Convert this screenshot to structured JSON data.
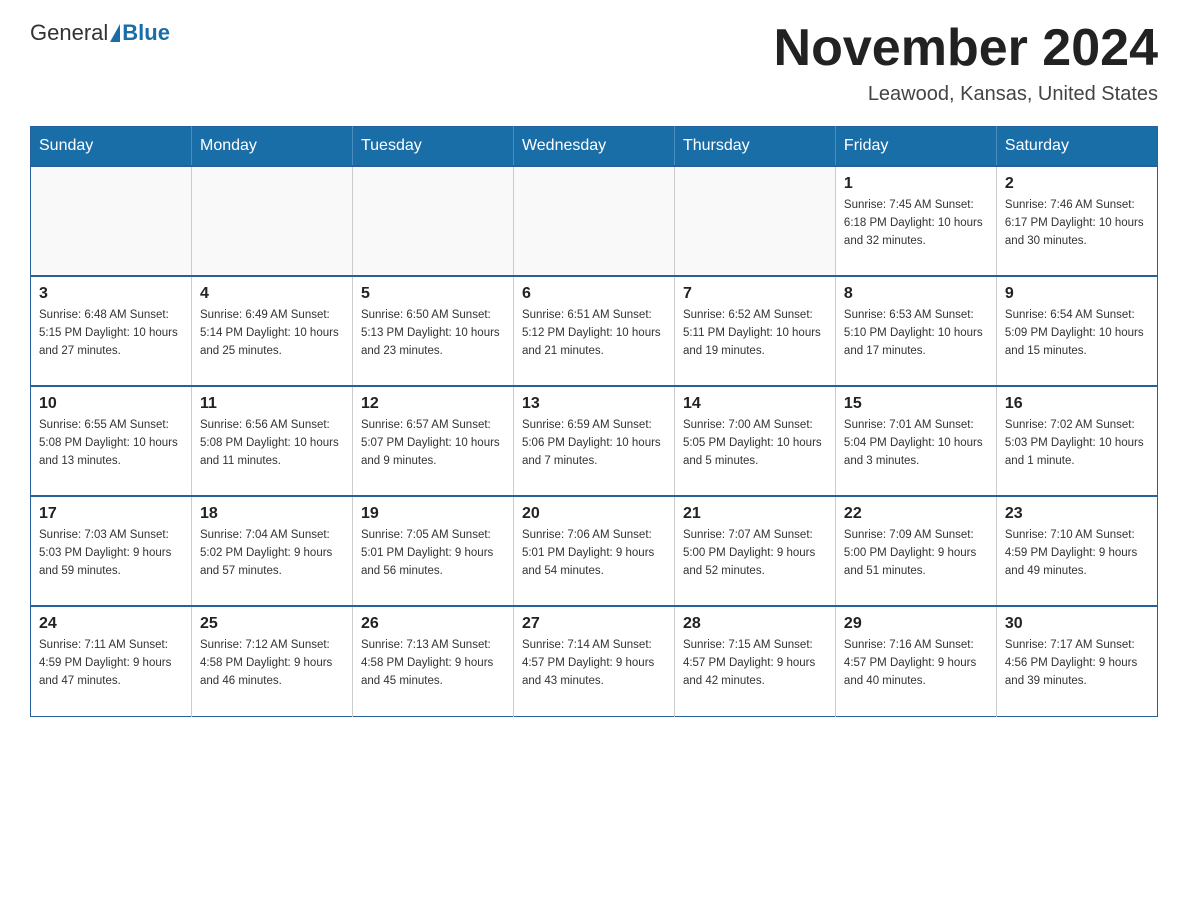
{
  "header": {
    "logo": {
      "general": "General",
      "blue": "Blue"
    },
    "title": "November 2024",
    "location": "Leawood, Kansas, United States"
  },
  "weekdays": [
    "Sunday",
    "Monday",
    "Tuesday",
    "Wednesday",
    "Thursday",
    "Friday",
    "Saturday"
  ],
  "weeks": [
    [
      {
        "day": "",
        "info": ""
      },
      {
        "day": "",
        "info": ""
      },
      {
        "day": "",
        "info": ""
      },
      {
        "day": "",
        "info": ""
      },
      {
        "day": "",
        "info": ""
      },
      {
        "day": "1",
        "info": "Sunrise: 7:45 AM\nSunset: 6:18 PM\nDaylight: 10 hours\nand 32 minutes."
      },
      {
        "day": "2",
        "info": "Sunrise: 7:46 AM\nSunset: 6:17 PM\nDaylight: 10 hours\nand 30 minutes."
      }
    ],
    [
      {
        "day": "3",
        "info": "Sunrise: 6:48 AM\nSunset: 5:15 PM\nDaylight: 10 hours\nand 27 minutes."
      },
      {
        "day": "4",
        "info": "Sunrise: 6:49 AM\nSunset: 5:14 PM\nDaylight: 10 hours\nand 25 minutes."
      },
      {
        "day": "5",
        "info": "Sunrise: 6:50 AM\nSunset: 5:13 PM\nDaylight: 10 hours\nand 23 minutes."
      },
      {
        "day": "6",
        "info": "Sunrise: 6:51 AM\nSunset: 5:12 PM\nDaylight: 10 hours\nand 21 minutes."
      },
      {
        "day": "7",
        "info": "Sunrise: 6:52 AM\nSunset: 5:11 PM\nDaylight: 10 hours\nand 19 minutes."
      },
      {
        "day": "8",
        "info": "Sunrise: 6:53 AM\nSunset: 5:10 PM\nDaylight: 10 hours\nand 17 minutes."
      },
      {
        "day": "9",
        "info": "Sunrise: 6:54 AM\nSunset: 5:09 PM\nDaylight: 10 hours\nand 15 minutes."
      }
    ],
    [
      {
        "day": "10",
        "info": "Sunrise: 6:55 AM\nSunset: 5:08 PM\nDaylight: 10 hours\nand 13 minutes."
      },
      {
        "day": "11",
        "info": "Sunrise: 6:56 AM\nSunset: 5:08 PM\nDaylight: 10 hours\nand 11 minutes."
      },
      {
        "day": "12",
        "info": "Sunrise: 6:57 AM\nSunset: 5:07 PM\nDaylight: 10 hours\nand 9 minutes."
      },
      {
        "day": "13",
        "info": "Sunrise: 6:59 AM\nSunset: 5:06 PM\nDaylight: 10 hours\nand 7 minutes."
      },
      {
        "day": "14",
        "info": "Sunrise: 7:00 AM\nSunset: 5:05 PM\nDaylight: 10 hours\nand 5 minutes."
      },
      {
        "day": "15",
        "info": "Sunrise: 7:01 AM\nSunset: 5:04 PM\nDaylight: 10 hours\nand 3 minutes."
      },
      {
        "day": "16",
        "info": "Sunrise: 7:02 AM\nSunset: 5:03 PM\nDaylight: 10 hours\nand 1 minute."
      }
    ],
    [
      {
        "day": "17",
        "info": "Sunrise: 7:03 AM\nSunset: 5:03 PM\nDaylight: 9 hours\nand 59 minutes."
      },
      {
        "day": "18",
        "info": "Sunrise: 7:04 AM\nSunset: 5:02 PM\nDaylight: 9 hours\nand 57 minutes."
      },
      {
        "day": "19",
        "info": "Sunrise: 7:05 AM\nSunset: 5:01 PM\nDaylight: 9 hours\nand 56 minutes."
      },
      {
        "day": "20",
        "info": "Sunrise: 7:06 AM\nSunset: 5:01 PM\nDaylight: 9 hours\nand 54 minutes."
      },
      {
        "day": "21",
        "info": "Sunrise: 7:07 AM\nSunset: 5:00 PM\nDaylight: 9 hours\nand 52 minutes."
      },
      {
        "day": "22",
        "info": "Sunrise: 7:09 AM\nSunset: 5:00 PM\nDaylight: 9 hours\nand 51 minutes."
      },
      {
        "day": "23",
        "info": "Sunrise: 7:10 AM\nSunset: 4:59 PM\nDaylight: 9 hours\nand 49 minutes."
      }
    ],
    [
      {
        "day": "24",
        "info": "Sunrise: 7:11 AM\nSunset: 4:59 PM\nDaylight: 9 hours\nand 47 minutes."
      },
      {
        "day": "25",
        "info": "Sunrise: 7:12 AM\nSunset: 4:58 PM\nDaylight: 9 hours\nand 46 minutes."
      },
      {
        "day": "26",
        "info": "Sunrise: 7:13 AM\nSunset: 4:58 PM\nDaylight: 9 hours\nand 45 minutes."
      },
      {
        "day": "27",
        "info": "Sunrise: 7:14 AM\nSunset: 4:57 PM\nDaylight: 9 hours\nand 43 minutes."
      },
      {
        "day": "28",
        "info": "Sunrise: 7:15 AM\nSunset: 4:57 PM\nDaylight: 9 hours\nand 42 minutes."
      },
      {
        "day": "29",
        "info": "Sunrise: 7:16 AM\nSunset: 4:57 PM\nDaylight: 9 hours\nand 40 minutes."
      },
      {
        "day": "30",
        "info": "Sunrise: 7:17 AM\nSunset: 4:56 PM\nDaylight: 9 hours\nand 39 minutes."
      }
    ]
  ]
}
